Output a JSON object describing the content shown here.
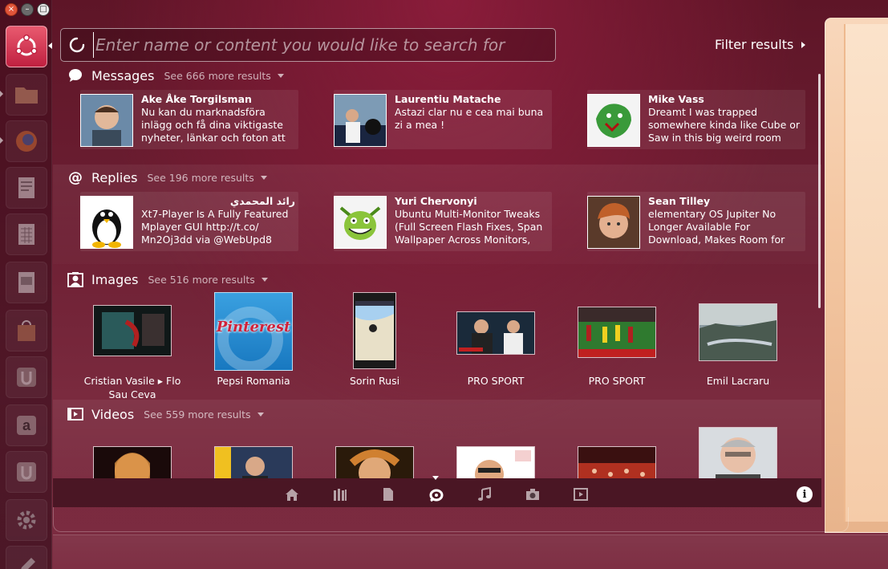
{
  "colors": {
    "accent": "#d12e4f",
    "text": "#ffffff",
    "muted": "#d8b6bf"
  },
  "launcher": {
    "items": [
      {
        "name": "dash-home",
        "icon": "ubuntu-logo-icon"
      },
      {
        "name": "files",
        "icon": "folder-icon"
      },
      {
        "name": "firefox",
        "icon": "firefox-icon"
      },
      {
        "name": "writer",
        "icon": "document-icon"
      },
      {
        "name": "calc",
        "icon": "spreadsheet-icon"
      },
      {
        "name": "impress",
        "icon": "presentation-icon"
      },
      {
        "name": "software-center",
        "icon": "shopping-bag-icon"
      },
      {
        "name": "ubuntu-one",
        "icon": "ubuntu-one-icon"
      },
      {
        "name": "amazon",
        "icon": "amazon-icon"
      },
      {
        "name": "ubuntu-one-music",
        "icon": "ubuntu-one-icon"
      },
      {
        "name": "system-settings",
        "icon": "gear-icon"
      },
      {
        "name": "text-editor",
        "icon": "pencil-icon"
      }
    ]
  },
  "search": {
    "placeholder": "Enter name or content you would like to search for",
    "value": ""
  },
  "filter": {
    "label": "Filter results"
  },
  "categories": {
    "messages": {
      "title": "Messages",
      "more": "See 666 more results",
      "items": [
        {
          "author": "Ake Åke Torgilsman",
          "text": "Nu kan du marknadsföra inlägg och få dina viktigaste nyheter, länkar och foton att hamna"
        },
        {
          "author": "Laurentiu Matache",
          "text": "Astazi clar nu e cea mai buna zi a mea !"
        },
        {
          "author": "Mike Vass",
          "text": "Dreamt I was trapped somewhere kinda like Cube or Saw in this big weird room with"
        }
      ]
    },
    "replies": {
      "title": "Replies",
      "more": "See 196 more results",
      "items": [
        {
          "author": "رائد المحمدي",
          "text": "Xt7-Player Is A Fully Featured Mplayer GUI http://t.co/ Mn2Oj3dd via @WebUpd8"
        },
        {
          "author": "Yuri Chervonyi",
          "text": "Ubuntu Multi-Monitor Tweaks (Full Screen Flash Fixes, Span Wallpaper Across Monitors,"
        },
        {
          "author": "Sean Tilley",
          "text": "elementary OS Jupiter No Longer Available For Download, Makes Room for"
        }
      ]
    },
    "images": {
      "title": "Images",
      "more": "See 516 more results",
      "items": [
        {
          "caption": "Cristian Vasile ▸ Flo Sau Ceva"
        },
        {
          "caption": "Pepsi Romania",
          "thumb_text": "Pinterest"
        },
        {
          "caption": "Sorin Rusi"
        },
        {
          "caption": "PRO SPORT"
        },
        {
          "caption": "PRO SPORT"
        },
        {
          "caption": "Emil Lacraru"
        }
      ]
    },
    "videos": {
      "title": "Videos",
      "more": "See 559 more results"
    }
  },
  "lenses": [
    {
      "name": "home-lens",
      "icon": "home-icon"
    },
    {
      "name": "applications-lens",
      "icon": "applications-icon"
    },
    {
      "name": "files-lens",
      "icon": "file-icon"
    },
    {
      "name": "social-lens",
      "icon": "social-icon",
      "active": true
    },
    {
      "name": "music-lens",
      "icon": "music-note-icon"
    },
    {
      "name": "photos-lens",
      "icon": "camera-icon"
    },
    {
      "name": "video-lens",
      "icon": "video-icon"
    }
  ],
  "info": {
    "label": "i"
  }
}
